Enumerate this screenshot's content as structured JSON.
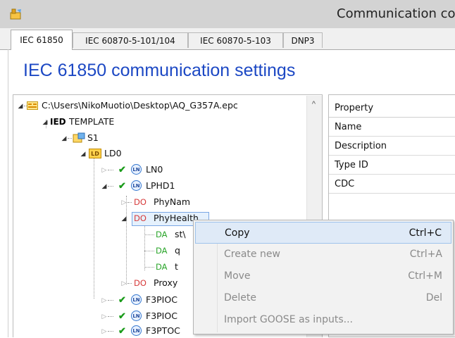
{
  "window": {
    "title": "Communication co"
  },
  "tabs": [
    {
      "label": "IEC 61850"
    },
    {
      "label": "IEC 60870-5-101/104"
    },
    {
      "label": "IEC 60870-5-103"
    },
    {
      "label": "DNP3"
    }
  ],
  "heading": "IEC 61850 communication settings",
  "tree": {
    "file": {
      "label": "C:\\Users\\NikoMuotio\\Desktop\\AQ_G357A.epc"
    },
    "ied": {
      "tag": "IED",
      "label": "TEMPLATE"
    },
    "server": {
      "label": "S1"
    },
    "ld": {
      "badge": "LD",
      "label": "LD0"
    },
    "ln_badge": "LN",
    "do_tag": "DO",
    "da_tag": "DA",
    "nodes": {
      "ln0": "LN0",
      "lphd1": "LPHD1",
      "phynam": "PhyNam",
      "phyhealth": "PhyHealth",
      "stval": "st\\",
      "q": "q",
      "t": "t",
      "proxy": "Proxy",
      "f3pioc1": "F3PIOC",
      "f3pioc2": "F3PIOC",
      "f3ptoc": "F3PTOC"
    }
  },
  "properties": {
    "header": "Property",
    "rows": [
      "Name",
      "Description",
      "Type ID",
      "CDC"
    ]
  },
  "context_menu": {
    "items": [
      {
        "label": "Copy",
        "shortcut": "Ctrl+C",
        "enabled": true
      },
      {
        "label": "Create new",
        "shortcut": "Ctrl+A",
        "enabled": false
      },
      {
        "label": "Move",
        "shortcut": "Ctrl+M",
        "enabled": false
      },
      {
        "label": "Delete",
        "shortcut": "Del",
        "enabled": false
      },
      {
        "label": "Import GOOSE as inputs...",
        "shortcut": "",
        "enabled": false
      }
    ]
  },
  "colors": {
    "heading": "#1c48c4",
    "do_tag": "#d63a3a",
    "da_tag": "#2aa52a",
    "check": "#1a9b1a",
    "accent": "#3477cf"
  }
}
